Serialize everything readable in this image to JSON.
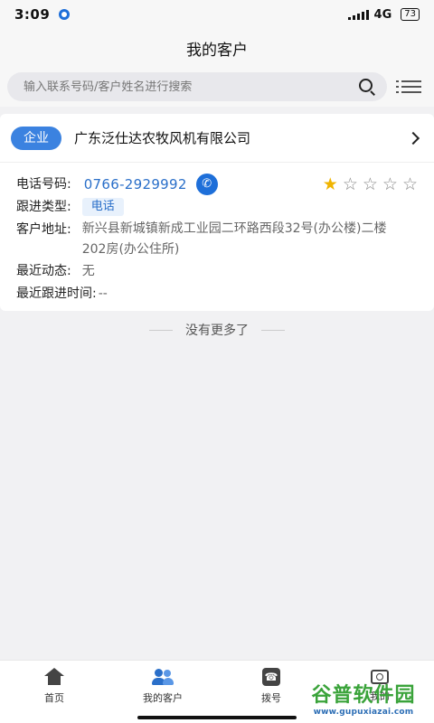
{
  "status_bar": {
    "time": "3:09",
    "network": "4G",
    "battery": "73"
  },
  "header": {
    "title": "我的客户"
  },
  "search": {
    "placeholder": "输入联系号码/客户姓名进行搜索"
  },
  "customer": {
    "type_tag": "企业",
    "name": "广东泛仕达农牧风机有限公司",
    "phone_label": "电话号码:",
    "phone": "0766-2929992",
    "rating": 1,
    "rating_max": 5,
    "followup_type_label": "跟进类型:",
    "followup_type": "电话",
    "address_label": "客户地址:",
    "address": "新兴县新城镇新成工业园二环路西段32号(办公楼)二楼202房(办公住所)",
    "recent_activity_label": "最近动态:",
    "recent_activity": "无",
    "last_followup_label": "最近跟进时间:",
    "last_followup": "--"
  },
  "list_end_text": "没有更多了",
  "tabbar": {
    "items": [
      {
        "label": "首页",
        "icon": "home-icon"
      },
      {
        "label": "我的客户",
        "icon": "customers-icon",
        "active": true
      },
      {
        "label": "拨号",
        "icon": "dial-icon"
      },
      {
        "label": "我的",
        "icon": "profile-icon"
      }
    ]
  },
  "watermark": {
    "main": "谷普软件园",
    "url": "www.gupuxiazai.com"
  },
  "colors": {
    "accent": "#3b82e0",
    "phone_text": "#2a6fc9",
    "star": "#f0b400"
  }
}
